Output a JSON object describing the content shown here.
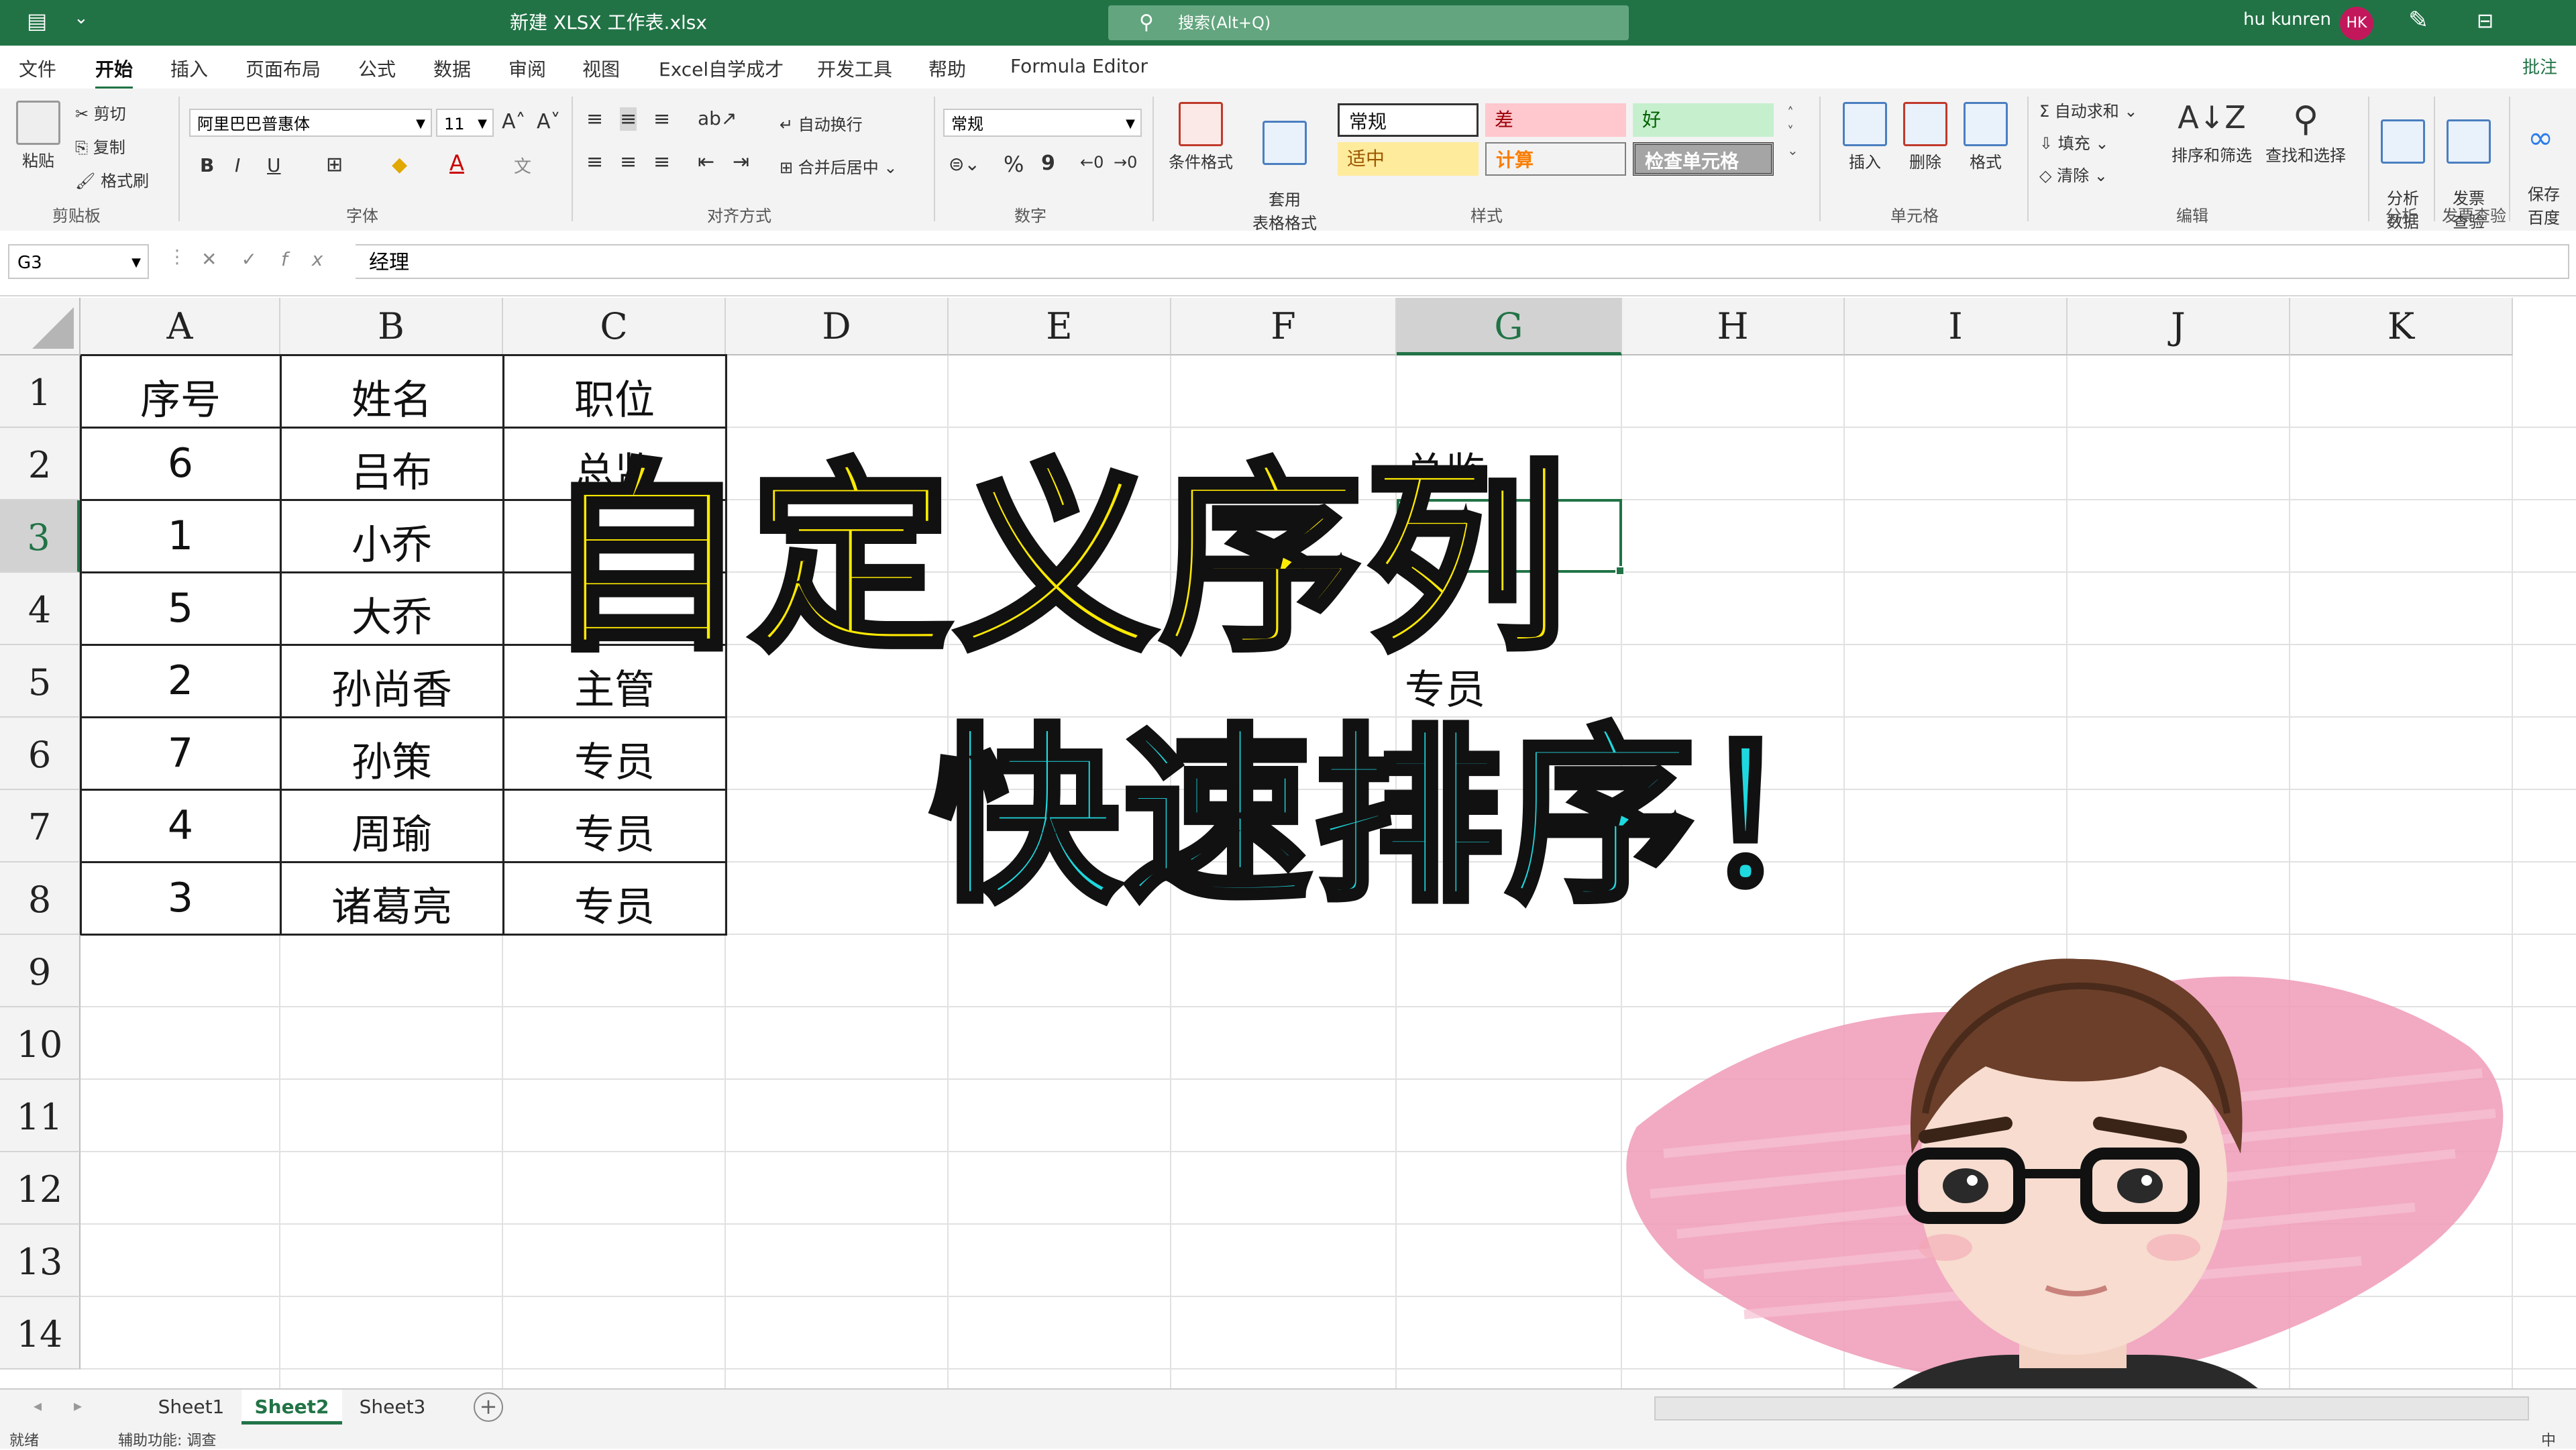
{
  "titlebar": {
    "file_name": "新建 XLSX 工作表.xlsx",
    "search_placeholder": "搜索(Alt+Q)",
    "user": "hu kunren",
    "avatar_initials": "HK",
    "accent": "#217346"
  },
  "menu": {
    "tabs": [
      "文件",
      "开始",
      "插入",
      "页面布局",
      "公式",
      "数据",
      "审阅",
      "视图",
      "Excel自学成才",
      "开发工具",
      "帮助",
      "Formula Editor"
    ],
    "active": "开始",
    "comment": "批注"
  },
  "ribbon": {
    "clipboard": {
      "paste": "粘贴",
      "cut": "剪切",
      "copy": "复制",
      "format_painter": "格式刷",
      "label": "剪贴板"
    },
    "font": {
      "name": "阿里巴巴普惠体",
      "size": "11",
      "bold": "B",
      "italic": "I",
      "underline": "U",
      "label": "字体"
    },
    "alignment": {
      "wrap": "自动换行",
      "merge": "合并后居中",
      "label": "对齐方式"
    },
    "number": {
      "format": "常规",
      "percent": "%",
      "comma": "9",
      "label": "数字"
    },
    "styles": {
      "conditional": "条件格式",
      "table": "套用\n表格格式",
      "normal": "常规",
      "bad": "差",
      "good": "好",
      "neutral": "适中",
      "calc": "计算",
      "check": "检查单元格",
      "label": "样式"
    },
    "cells": {
      "insert": "插入",
      "delete": "删除",
      "format": "格式",
      "label": "单元格"
    },
    "editing": {
      "autosum": "自动求和",
      "fill": "填充",
      "clear": "清除",
      "sort": "排序和筛选",
      "find": "查找和选择",
      "label": "编辑"
    },
    "analysis": {
      "analyze": "分析\n数据",
      "label": "分析"
    },
    "invoice": {
      "check": "发票\n查验",
      "label": "发票查验"
    },
    "extra": {
      "save": "保存\n百度"
    }
  },
  "formula": {
    "cell_ref": "G3",
    "content": "经理"
  },
  "grid": {
    "columns": [
      "A",
      "B",
      "C",
      "D",
      "E",
      "F",
      "G",
      "H",
      "I",
      "J",
      "K"
    ],
    "selected_column": "G",
    "rows": [
      "1",
      "2",
      "3",
      "4",
      "5",
      "6",
      "7",
      "8",
      "9",
      "10",
      "11",
      "12",
      "13",
      "14"
    ],
    "selected_row": "3",
    "table": [
      [
        "序号",
        "姓名",
        "职位"
      ],
      [
        "6",
        "吕布",
        "总监"
      ],
      [
        "1",
        "小乔",
        ""
      ],
      [
        "5",
        "大乔",
        ""
      ],
      [
        "2",
        "孙尚香",
        "主管"
      ],
      [
        "7",
        "孙策",
        "专员"
      ],
      [
        "4",
        "周瑜",
        "专员"
      ],
      [
        "3",
        "诸葛亮",
        "专员"
      ]
    ],
    "custom_list": {
      "g2": "总监",
      "g5": "专员"
    }
  },
  "overlay": {
    "title": "自定义序列",
    "subtitle": "快速排序！"
  },
  "sheets": {
    "tabs": [
      "Sheet1",
      "Sheet2",
      "Sheet3"
    ],
    "active": "Sheet2",
    "add": "+"
  },
  "status": {
    "ready": "就绪",
    "accessibility": "辅助功能: 调查",
    "mode": "中"
  }
}
